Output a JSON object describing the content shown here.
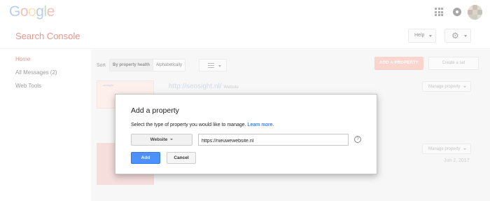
{
  "brand": {
    "letters": [
      {
        "ch": "G",
        "color": "#8aa9e0"
      },
      {
        "ch": "o",
        "color": "#e79088"
      },
      {
        "ch": "o",
        "color": "#f2d47a"
      },
      {
        "ch": "g",
        "color": "#8aa9e0"
      },
      {
        "ch": "l",
        "color": "#93c996"
      },
      {
        "ch": "e",
        "color": "#e79088"
      }
    ],
    "product": "Search Console"
  },
  "header": {
    "help_label": "Help"
  },
  "sidebar": {
    "items": [
      {
        "label": "Home",
        "active": true
      },
      {
        "label": "All Messages (2)",
        "active": false
      },
      {
        "label": "Web Tools",
        "active": false
      }
    ]
  },
  "toolbar": {
    "sort_label": "Sort",
    "sort_options": [
      "By property health",
      "Alphabetically"
    ],
    "add_property_label": "ADD A PROPERTY",
    "create_set_label": "Create a set"
  },
  "properties": [
    {
      "url": "http://seosight.nl/",
      "type": "Website",
      "manage_label": "Manage property",
      "thumb_text": "seosight"
    },
    {
      "manage_label": "Manage property",
      "date": "Jun 2, 2017"
    }
  ],
  "dialog": {
    "title": "Add a property",
    "description": "Select the type of property you would like to manage.",
    "learn_more": "Learn more.",
    "type_value": "Website",
    "url_value": "https://nieuwewebsite.nl",
    "help_glyph": "?",
    "add_label": "Add",
    "cancel_label": "Cancel"
  },
  "icons": {
    "apps": "apps-grid-icon",
    "notifications": "notifications-icon",
    "settings": "gear-icon",
    "list_view": "list-view-icon",
    "help": "help-circle-icon"
  },
  "colors": {
    "brand_red": "#dd4b39",
    "primary_blue": "#4d90fe",
    "link_blue": "#1155cc"
  }
}
